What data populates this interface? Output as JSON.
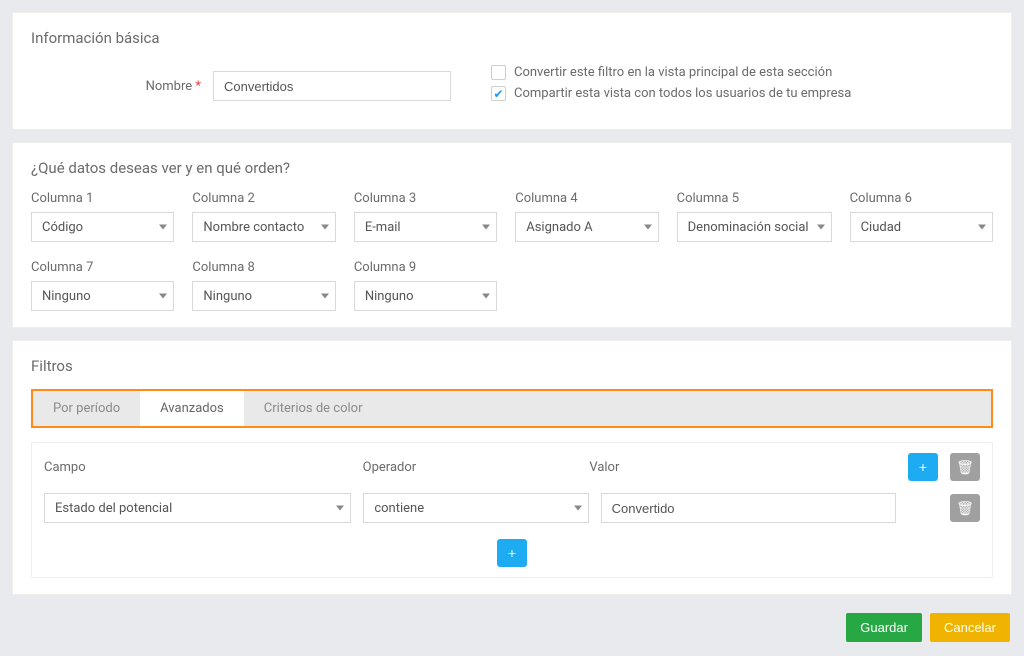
{
  "basic": {
    "section_title": "Información básica",
    "name_label": "Nombre",
    "asterisk": "*",
    "name_value": "Convertidos",
    "checkboxes": [
      {
        "label": "Convertir este filtro en la vista principal de esta sección",
        "checked": false
      },
      {
        "label": "Compartir esta vista con todos los usuarios de tu empresa",
        "checked": true
      }
    ]
  },
  "columns": {
    "section_title": "¿Qué datos deseas ver y en qué orden?",
    "items": [
      {
        "label": "Columna 1",
        "value": "Código"
      },
      {
        "label": "Columna 2",
        "value": "Nombre contacto"
      },
      {
        "label": "Columna 3",
        "value": "E-mail"
      },
      {
        "label": "Columna 4",
        "value": "Asignado A"
      },
      {
        "label": "Columna 5",
        "value": "Denominación social"
      },
      {
        "label": "Columna 6",
        "value": "Ciudad"
      },
      {
        "label": "Columna 7",
        "value": "Ninguno"
      },
      {
        "label": "Columna 8",
        "value": "Ninguno"
      },
      {
        "label": "Columna 9",
        "value": "Ninguno"
      }
    ]
  },
  "filters": {
    "section_title": "Filtros",
    "tabs": [
      {
        "label": "Por período",
        "active": false
      },
      {
        "label": "Avanzados",
        "active": true
      },
      {
        "label": "Criterios de color",
        "active": false
      }
    ],
    "headers": {
      "campo": "Campo",
      "operador": "Operador",
      "valor": "Valor"
    },
    "rows": [
      {
        "campo": "Estado del potencial",
        "operador": "contiene",
        "valor": "Convertido"
      }
    ]
  },
  "footer": {
    "save": "Guardar",
    "cancel": "Cancelar"
  },
  "icons": {
    "plus": "+",
    "trash": "🗑",
    "check": "✔"
  }
}
